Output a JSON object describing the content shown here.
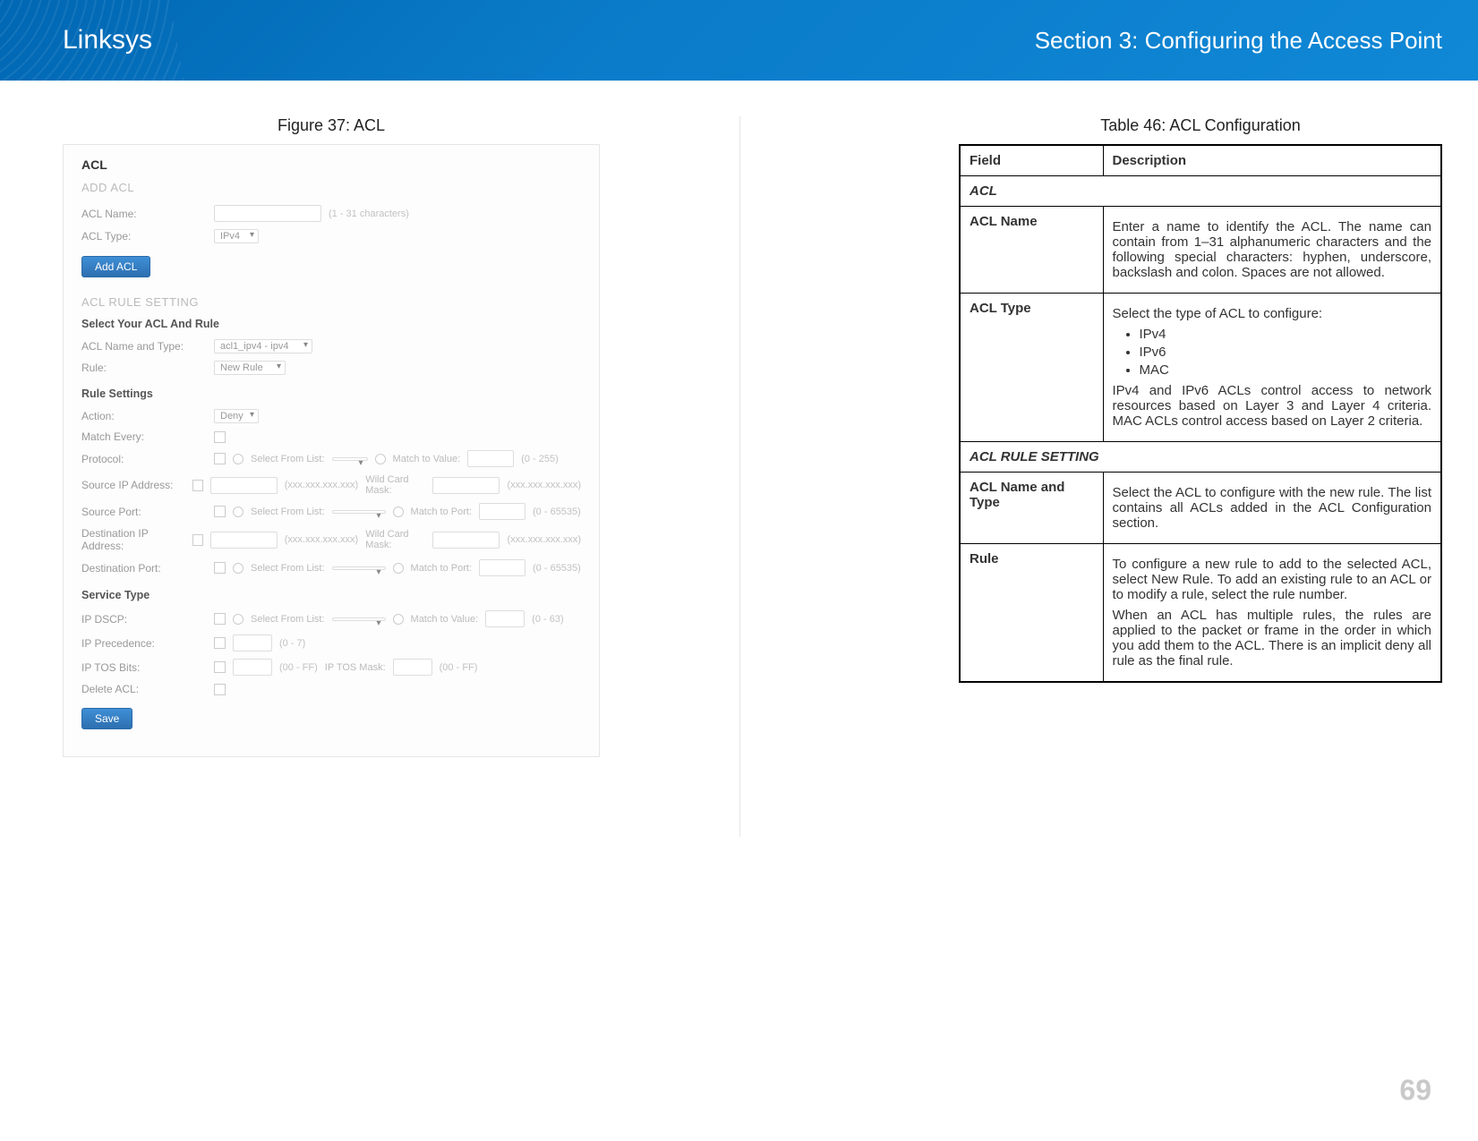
{
  "header": {
    "brand": "Linksys",
    "section": "Section 3:  Configuring the Access Point"
  },
  "figure": {
    "title": "Figure 37: ACL",
    "acl_heading": "ACL",
    "add_acl": "ADD ACL",
    "acl_name_label": "ACL Name:",
    "acl_name_hint": "(1 - 31 characters)",
    "acl_type_label": "ACL Type:",
    "acl_type_value": "IPv4",
    "add_acl_btn": "Add ACL",
    "rule_setting": "ACL RULE SETTING",
    "select_rule": "Select Your ACL And Rule",
    "acl_name_type_label": "ACL Name and Type:",
    "acl_name_type_value": "acl1_ipv4 - ipv4",
    "rule_label": "Rule:",
    "rule_value": "New Rule",
    "rule_settings": "Rule Settings",
    "action_label": "Action:",
    "action_value": "Deny",
    "match_every_label": "Match Every:",
    "protocol_label": "Protocol:",
    "select_from_list": "Select From List:",
    "match_to_value": "Match to Value:",
    "protocol_hint": "(0 - 255)",
    "src_ip_label": "Source IP Address:",
    "ip_format": "(xxx.xxx.xxx.xxx)",
    "wild_card_mask": "Wild Card Mask:",
    "src_port_label": "Source Port:",
    "match_to_port": "Match to Port:",
    "port_hint": "(0 - 65535)",
    "dst_ip_label": "Destination IP Address:",
    "dst_port_label": "Destination Port:",
    "service_type": "Service Type",
    "ip_dscp_label": "IP DSCP:",
    "dscp_hint": "(0 - 63)",
    "ip_precedence_label": "IP Precedence:",
    "prec_hint": "(0 - 7)",
    "ip_tos_bits_label": "IP TOS Bits:",
    "tos_hint": "(00 - FF)",
    "ip_tos_mask": "IP TOS Mask:",
    "tos_mask_hint": "(00 - FF)",
    "delete_acl_label": "Delete ACL:",
    "save_btn": "Save"
  },
  "table": {
    "title": "Table 46: ACL Configuration",
    "header_field": "Field",
    "header_desc": "Description",
    "section_acl": "ACL",
    "rows": [
      {
        "field": "ACL Name",
        "desc": "Enter a name to identify the ACL. The name can contain from 1–31 alphanumeric characters and the following special characters: hyphen, underscore, backslash and colon. Spaces are not allowed."
      },
      {
        "field": "ACL Type",
        "desc_intro": "Select the type of ACL to configure:",
        "bullets": [
          "IPv4",
          "IPv6",
          "MAC"
        ],
        "desc_after": "IPv4 and IPv6 ACLs control access to network resources based on Layer 3 and Layer 4 criteria. MAC ACLs control access based on Layer 2 criteria."
      }
    ],
    "section_rule": "ACL RULE SETTING",
    "rows2": [
      {
        "field": "ACL Name and Type",
        "desc": "Select the ACL to configure with the new rule. The list contains all ACLs added in the ACL Configuration section."
      },
      {
        "field": "Rule",
        "desc": "To configure a new rule to add to the selected ACL, select New Rule. To add an existing rule to an ACL or to modify a rule, select the rule number.",
        "desc2": "When an ACL has multiple rules, the rules are applied to the packet or frame in the order in which you add them to the ACL. There is an implicit deny all rule as the final rule."
      }
    ]
  },
  "page_number": "69"
}
